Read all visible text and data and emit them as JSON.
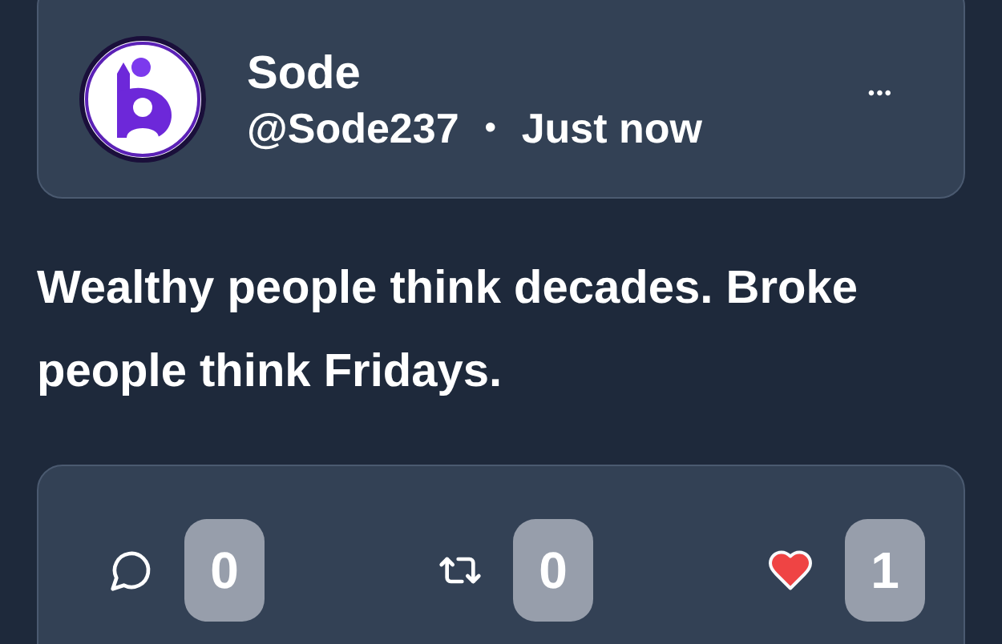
{
  "post": {
    "author": {
      "name": "Sode",
      "handle": "@Sode237",
      "separator": "•",
      "time": "Just now"
    },
    "menu": "•••",
    "text": "Wealthy people think decades. Broke people think Fridays.",
    "actions": [
      {
        "kind": "comment",
        "count": "0",
        "active": false
      },
      {
        "kind": "repost",
        "count": "0",
        "active": false
      },
      {
        "kind": "like",
        "count": "1",
        "active": true
      }
    ]
  }
}
